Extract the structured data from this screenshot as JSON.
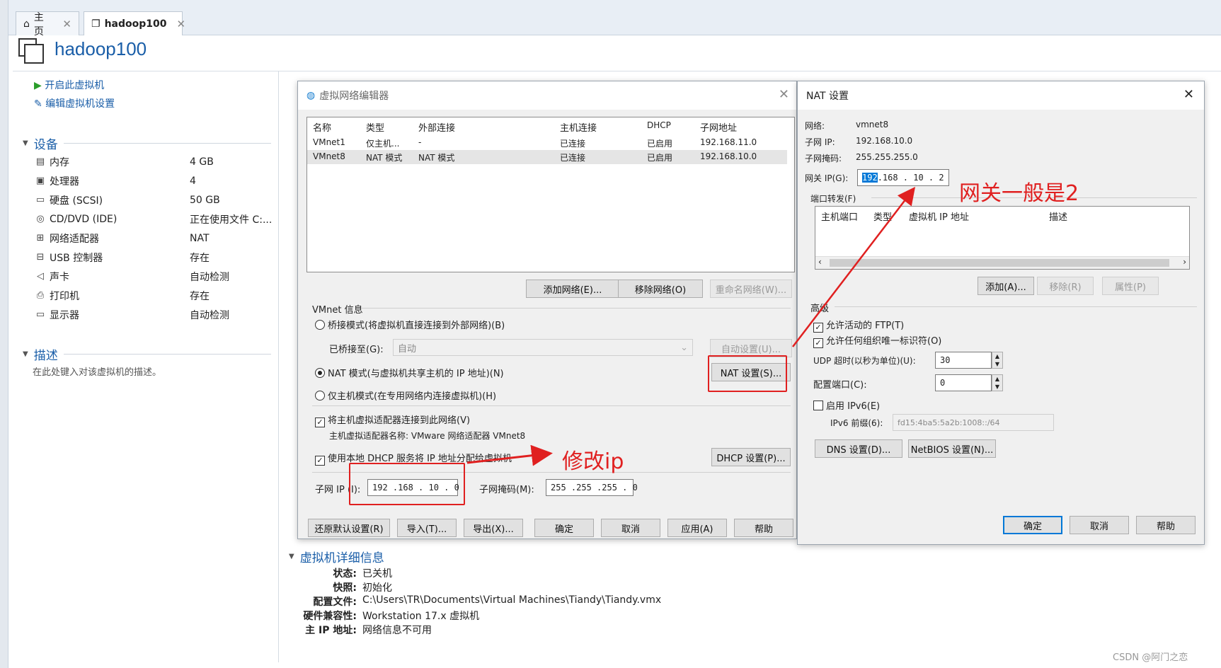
{
  "tabs": [
    {
      "label": "主页"
    },
    {
      "label": "hadoop100"
    }
  ],
  "vm": {
    "title": "hadoop100",
    "actions": {
      "power_on": "开启此虚拟机",
      "edit_settings": "编辑虚拟机设置"
    },
    "devices_section": "设备",
    "devices": [
      {
        "name": "内存",
        "value": "4 GB"
      },
      {
        "name": "处理器",
        "value": "4"
      },
      {
        "name": "硬盘 (SCSI)",
        "value": "50 GB"
      },
      {
        "name": "CD/DVD (IDE)",
        "value": "正在使用文件 C:..."
      },
      {
        "name": "网络适配器",
        "value": "NAT"
      },
      {
        "name": "USB 控制器",
        "value": "存在"
      },
      {
        "name": "声卡",
        "value": "自动检测"
      },
      {
        "name": "打印机",
        "value": "存在"
      },
      {
        "name": "显示器",
        "value": "自动检测"
      }
    ],
    "description_section": "描述",
    "description_placeholder": "在此处键入对该虚拟机的描述。",
    "details_section": "虚拟机详细信息",
    "details": [
      {
        "key": "状态:",
        "value": "已关机"
      },
      {
        "key": "快照:",
        "value": "初始化"
      },
      {
        "key": "配置文件:",
        "value": "C:\\Users\\TR\\Documents\\Virtual Machines\\Tiandy\\Tiandy.vmx"
      },
      {
        "key": "硬件兼容性:",
        "value": "Workstation 17.x 虚拟机"
      },
      {
        "key": "主 IP 地址:",
        "value": "网络信息不可用"
      }
    ]
  },
  "vne": {
    "title": "虚拟网络编辑器",
    "columns": [
      "名称",
      "类型",
      "外部连接",
      "主机连接",
      "DHCP",
      "子网地址"
    ],
    "rows": [
      [
        "VMnet1",
        "仅主机...",
        "-",
        "已连接",
        "已启用",
        "192.168.11.0"
      ],
      [
        "VMnet8",
        "NAT 模式",
        "NAT 模式",
        "已连接",
        "已启用",
        "192.168.10.0"
      ]
    ],
    "btn_add_network": "添加网络(E)...",
    "btn_remove_network": "移除网络(O)",
    "btn_rename_network": "重命名网络(W)...",
    "vmnet_info": "VMnet 信息",
    "radio_bridge": "桥接模式(将虚拟机直接连接到外部网络)(B)",
    "bridged_to_label": "已桥接至(G):",
    "bridged_to_value": "自动",
    "btn_auto_settings": "自动设置(U)...",
    "radio_nat": "NAT 模式(与虚拟机共享主机的 IP 地址)(N)",
    "btn_nat_settings": "NAT 设置(S)...",
    "radio_host_only": "仅主机模式(在专用网络内连接虚拟机)(H)",
    "chk_connect_adapter": "将主机虚拟适配器连接到此网络(V)",
    "adapter_name": "主机虚拟适配器名称: VMware 网络适配器 VMnet8",
    "chk_dhcp": "使用本地 DHCP 服务将 IP 地址分配给虚拟机",
    "btn_dhcp_settings": "DHCP 设置(P)...",
    "subnet_ip_label": "子网 IP (I):",
    "subnet_ip_value": "192 .168 . 10  .  0",
    "subnet_mask_label": "子网掩码(M):",
    "subnet_mask_value": "255 .255 .255 .  0",
    "btn_restore": "还原默认设置(R)",
    "btn_import": "导入(T)...",
    "btn_export": "导出(X)...",
    "btn_ok": "确定",
    "btn_cancel": "取消",
    "btn_apply": "应用(A)",
    "btn_help": "帮助"
  },
  "nat": {
    "title": "NAT 设置",
    "network_label": "网络:",
    "network_value": "vmnet8",
    "subnet_ip_label": "子网 IP:",
    "subnet_ip_value": "192.168.10.0",
    "subnet_mask_label": "子网掩码:",
    "subnet_mask_value": "255.255.255.0",
    "gateway_label": "网关 IP(G):",
    "gateway_selected": "192",
    "gateway_rest": " .168 . 10  .  2",
    "port_forward_label": "端口转发(F)",
    "pf_columns": [
      "主机端口",
      "类型",
      "虚拟机 IP 地址",
      "描述"
    ],
    "btn_add": "添加(A)...",
    "btn_remove": "移除(R)",
    "btn_properties": "属性(P)",
    "advanced_label": "高级",
    "chk_ftp": "允许活动的 FTP(T)",
    "chk_oui": "允许任何组织唯一标识符(O)",
    "udp_label": "UDP 超时(以秒为单位)(U):",
    "udp_value": "30",
    "config_port_label": "配置端口(C):",
    "config_port_value": "0",
    "chk_ipv6": "启用 IPv6(E)",
    "ipv6_prefix_label": "IPv6 前缀(6):",
    "ipv6_prefix_value": "fd15:4ba5:5a2b:1008::/64",
    "btn_dns": "DNS 设置(D)...",
    "btn_netbios": "NetBIOS 设置(N)...",
    "btn_ok": "确定",
    "btn_cancel": "取消",
    "btn_help": "帮助"
  },
  "annotations": {
    "gateway_note": "网关一般是2",
    "modify_ip_note": "修改ip",
    "color": "#e02020"
  },
  "watermark": "CSDN @阿门之恋"
}
